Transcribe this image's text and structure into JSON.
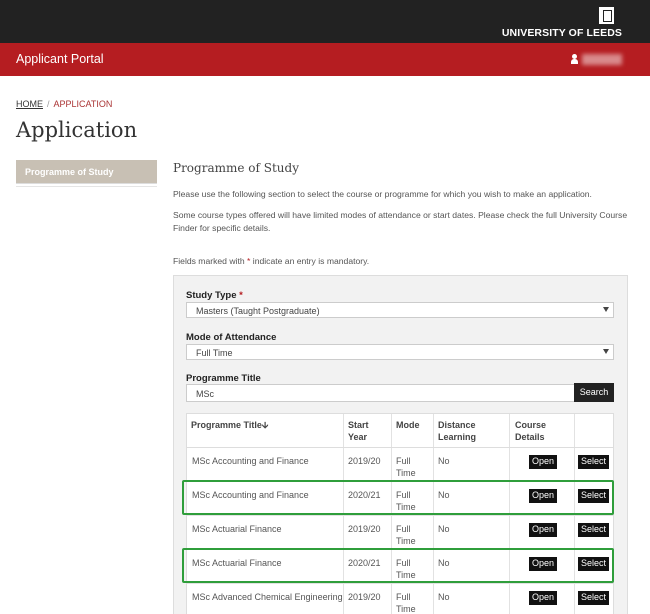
{
  "header": {
    "university": "UNIVERSITY OF LEEDS",
    "portal_title": "Applicant Portal"
  },
  "breadcrumb": {
    "home": "HOME",
    "separator": "/",
    "current": "APPLICATION"
  },
  "page_title": "Application",
  "sidebar": {
    "items": [
      {
        "label": "Programme of Study"
      }
    ]
  },
  "main": {
    "section_title": "Programme of Study",
    "intro": "Please use the following section to select the course or programme for which you wish to make an application.",
    "note": "Some course types offered will have limited modes of attendance or start dates. Please check the full University Course Finder for specific details.",
    "mandatory_prefix": "Fields marked with ",
    "mandatory_star": "*",
    "mandatory_suffix": " indicate an entry is mandatory."
  },
  "form": {
    "study_type_label": "Study Type",
    "required_star": "*",
    "study_type_value": "Masters (Taught Postgraduate)",
    "mode_label": "Mode of Attendance",
    "mode_value": "Full Time",
    "programme_title_label": "Programme Title",
    "programme_title_value": "MSc",
    "search_label": "Search"
  },
  "table": {
    "headers": {
      "title": "Programme Title🡫",
      "start": [
        "Start",
        "Year"
      ],
      "mode": "Mode",
      "distance": [
        "Distance",
        "Learning"
      ],
      "course": [
        "Course",
        "Details"
      ]
    },
    "rows": [
      {
        "title": "MSc Accounting and Finance",
        "start": "2019/20",
        "mode": [
          "Full",
          "Time"
        ],
        "distance": "No",
        "open": "Open",
        "select": "Select"
      },
      {
        "title": "MSc Accounting and Finance",
        "start": "2020/21",
        "mode": [
          "Full",
          "Time"
        ],
        "distance": "No",
        "open": "Open",
        "select": "Select"
      },
      {
        "title": "MSc Actuarial Finance",
        "start": "2019/20",
        "mode": [
          "Full",
          "Time"
        ],
        "distance": "No",
        "open": "Open",
        "select": "Select"
      },
      {
        "title": "MSc Actuarial Finance",
        "start": "2020/21",
        "mode": [
          "Full",
          "Time"
        ],
        "distance": "No",
        "open": "Open",
        "select": "Select"
      },
      {
        "title": "MSc Advanced Chemical Engineering",
        "start": "2019/20",
        "mode": [
          "Full",
          "Time"
        ],
        "distance": "No",
        "open": "Open",
        "select": "Select"
      }
    ]
  },
  "colors": {
    "brand_red": "#b51d21",
    "highlight_green": "#2f9e3b",
    "sidebar_active": "#c8c0b4"
  }
}
